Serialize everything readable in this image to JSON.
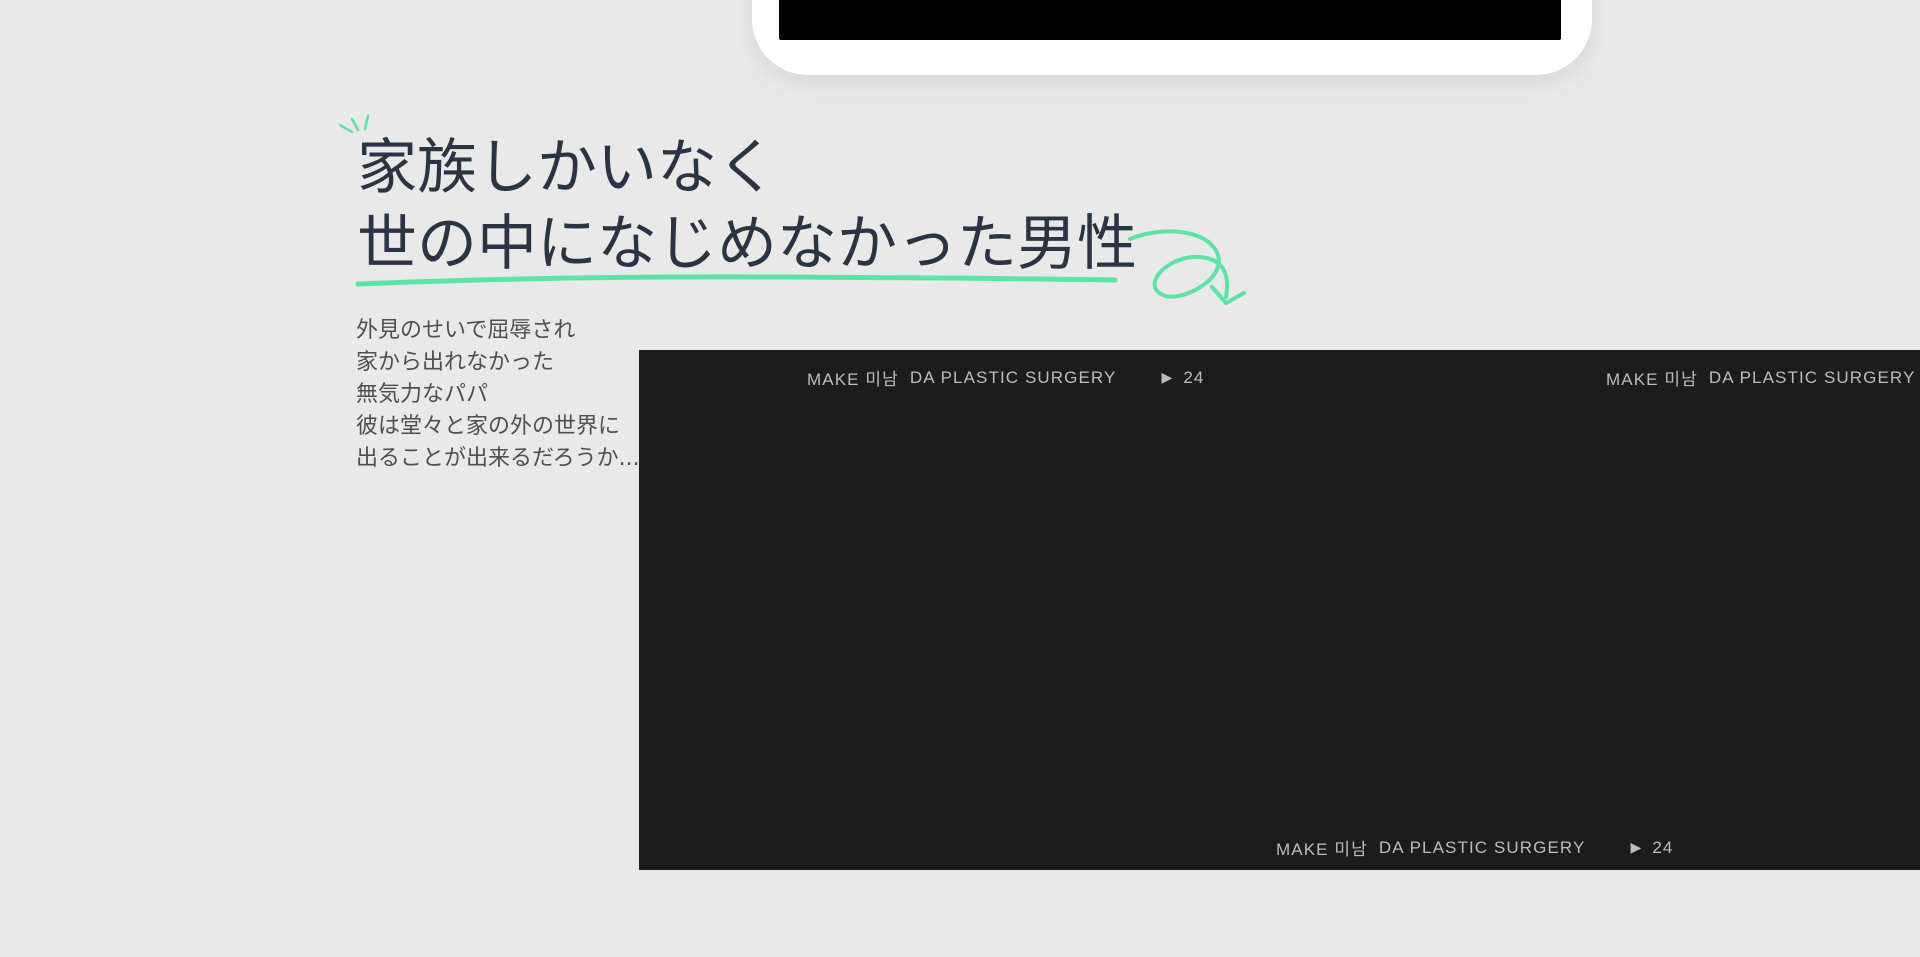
{
  "headline": {
    "line1": "家族しかいなく",
    "line2": "世の中になじめなかった男性"
  },
  "description": [
    "外見のせいで屈辱され",
    "家から出れなかった",
    "無気力なパパ",
    "彼は堂々と家の外の世界に",
    "出ることが出来るだろうか..."
  ],
  "video": {
    "ticker_brand": "MAKE 미남",
    "ticker_title": "DA PLASTIC SURGERY",
    "play_icon": "▶",
    "count": "24"
  },
  "colors": {
    "accent": "#5ee3a6",
    "headline": "#2a3442",
    "panel": "#1c1c1c",
    "background": "#e9e9e9"
  },
  "icons": {
    "spark": "spark-icon",
    "swirl": "swirl-arrow-icon",
    "play": "play-icon"
  }
}
